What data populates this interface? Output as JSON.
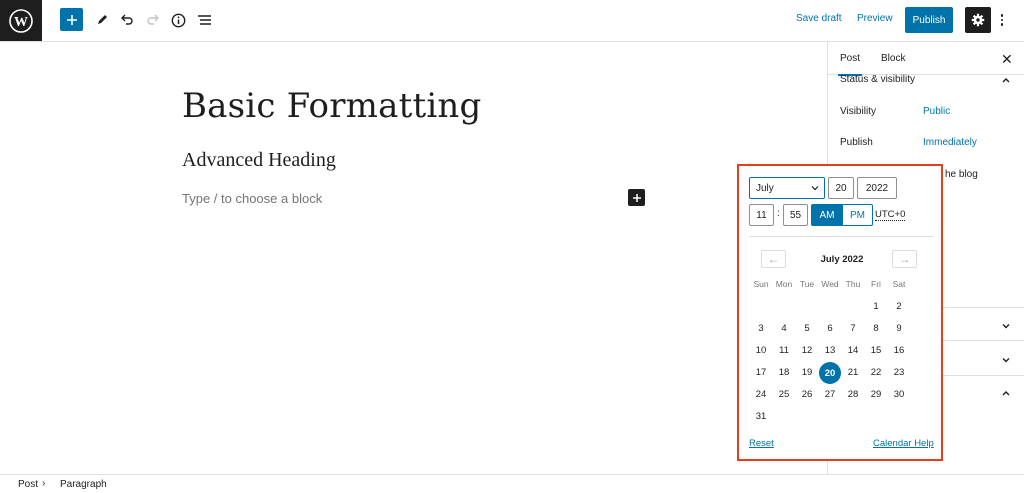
{
  "toolbar": {
    "logo_icon": "wordpress-logo-icon",
    "save_draft": "Save draft",
    "preview": "Preview",
    "publish": "Publish",
    "accent": "#0073aa"
  },
  "editor": {
    "title": "Basic Formatting",
    "heading": "Advanced Heading",
    "placeholder": "Type / to choose a block"
  },
  "sidebar": {
    "tabs": [
      "Post",
      "Block"
    ],
    "panel_title": "Status & visibility",
    "visibility_label": "Visibility",
    "visibility_value": "Public",
    "publish_label": "Publish",
    "publish_value": "Immediately",
    "partial_text": "he blog"
  },
  "datepicker": {
    "month": "July",
    "day": "20",
    "year": "2022",
    "hour": "11",
    "minute": "55",
    "am": "AM",
    "pm": "PM",
    "timezone": "UTC+0",
    "calendar_title": "July 2022",
    "prev_arrow": "←",
    "next_arrow": "→",
    "weekdays": [
      "Sun",
      "Mon",
      "Tue",
      "Wed",
      "Thu",
      "Fri",
      "Sat"
    ],
    "first_weekday_index": 5,
    "days_in_month": 31,
    "selected_day": 20,
    "reset": "Reset",
    "help": "Calendar Help",
    "highlight_color": "#e2401c"
  },
  "footer": {
    "crumbs": [
      "Post",
      "Paragraph"
    ]
  }
}
